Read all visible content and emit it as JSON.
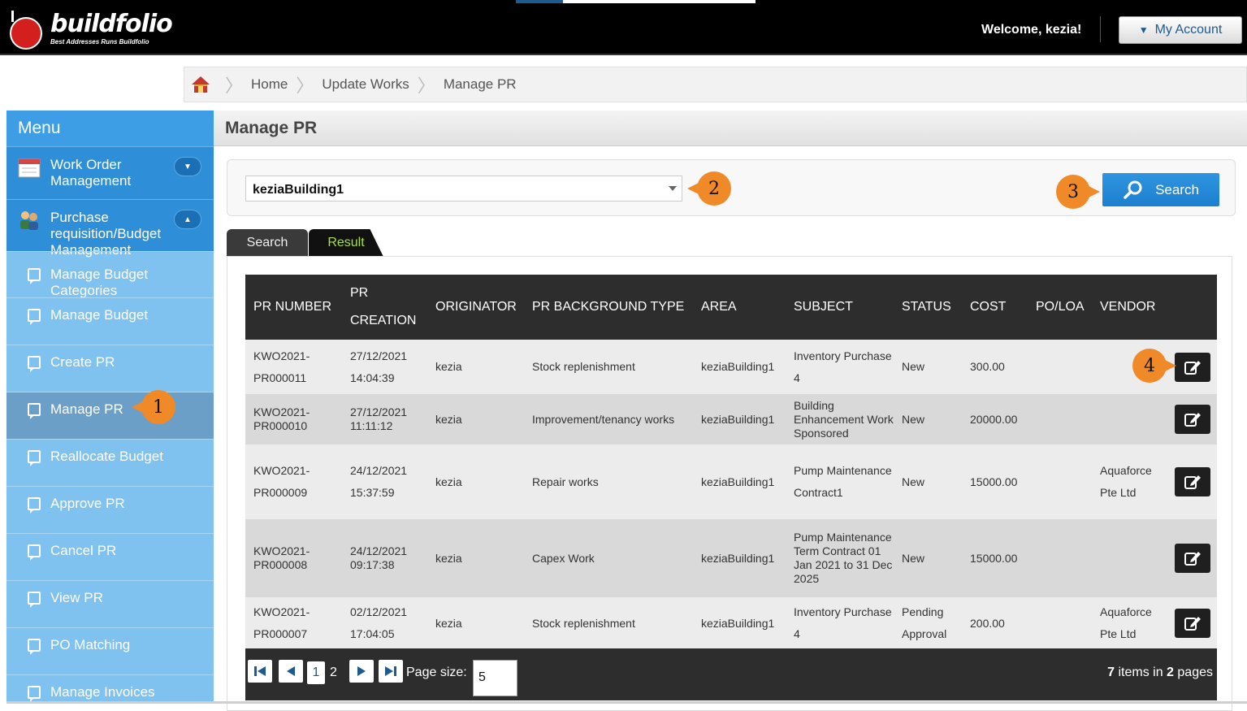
{
  "header": {
    "brand": "buildfolio",
    "tagline": "Best Addresses Runs Buildfolio",
    "welcome": "Welcome, kezia!",
    "account_label": "My Account"
  },
  "breadcrumb": [
    "Home",
    "Update Works",
    "Manage PR"
  ],
  "sidebar": {
    "title": "Menu",
    "groups": [
      {
        "label": "Work Order Management"
      },
      {
        "label": "Purchase requisition/Budget Management"
      }
    ],
    "items": [
      {
        "label": "Manage Budget Categories"
      },
      {
        "label": "Manage Budget"
      },
      {
        "label": "Create PR"
      },
      {
        "label": "Manage PR"
      },
      {
        "label": "Reallocate Budget"
      },
      {
        "label": "Approve PR"
      },
      {
        "label": "Cancel PR"
      },
      {
        "label": "View PR"
      },
      {
        "label": "PO Matching"
      },
      {
        "label": "Manage Invoices"
      }
    ]
  },
  "main": {
    "title": "Manage PR",
    "building_select": "keziaBuilding1",
    "search_label": "Search",
    "tabs": [
      "Search",
      "Result"
    ],
    "columns": [
      "PR NUMBER",
      "PR CREATION",
      "ORIGINATOR",
      "PR BACKGROUND TYPE",
      "AREA",
      "SUBJECT",
      "STATUS",
      "COST",
      "PO/LOA",
      "VENDOR"
    ],
    "rows": [
      {
        "pr_number": "KWO2021-PR000011",
        "creation": "27/12/2021 14:04:39",
        "originator": "kezia",
        "type": "Stock replenishment",
        "area": "keziaBuilding1",
        "subject": "Inventory Purchase 4",
        "status": "New",
        "cost": "300.00",
        "po": "",
        "vendor": ""
      },
      {
        "pr_number": "KWO2021-PR000010",
        "creation": "27/12/2021 11:11:12",
        "originator": "kezia",
        "type": "Improvement/tenancy works",
        "area": "keziaBuilding1",
        "subject": "Building Enhancement Work Sponsored",
        "status": "New",
        "cost": "20000.00",
        "po": "",
        "vendor": ""
      },
      {
        "pr_number": "KWO2021-PR000009",
        "creation": "24/12/2021 15:37:59",
        "originator": "kezia",
        "type": "Repair works",
        "area": "keziaBuilding1",
        "subject": "Pump Maintenance Contract1",
        "status": "New",
        "cost": "15000.00",
        "po": "",
        "vendor": "Aquaforce Pte Ltd"
      },
      {
        "pr_number": "KWO2021-PR000008",
        "creation": "24/12/2021 09:17:38",
        "originator": "kezia",
        "type": "Capex Work",
        "area": "keziaBuilding1",
        "subject": "Pump Maintenance Term Contract 01 Jan 2021 to 31 Dec 2025",
        "status": "New",
        "cost": "15000.00",
        "po": "",
        "vendor": ""
      },
      {
        "pr_number": "KWO2021-PR000007",
        "creation": "02/12/2021 17:04:05",
        "originator": "kezia",
        "type": "Stock replenishment",
        "area": "keziaBuilding1",
        "subject": "Inventory Purchase 4",
        "status": "Pending Approval",
        "cost": "200.00",
        "po": "",
        "vendor": "Aquaforce Pte Ltd"
      }
    ],
    "pager": {
      "current_page": "1",
      "other_page": "2",
      "page_size_label": "Page size:",
      "page_size": "5",
      "items_count": "7",
      "items_text": "items in",
      "pages_count": "2",
      "pages_text": "pages"
    }
  },
  "callouts": [
    "1",
    "2",
    "3",
    "4"
  ],
  "colors": {
    "accent": "#2e8fd8",
    "sidebar": "#7fc1ef",
    "callout": "#f08a28",
    "result_tab_text": "#a8e03a"
  }
}
